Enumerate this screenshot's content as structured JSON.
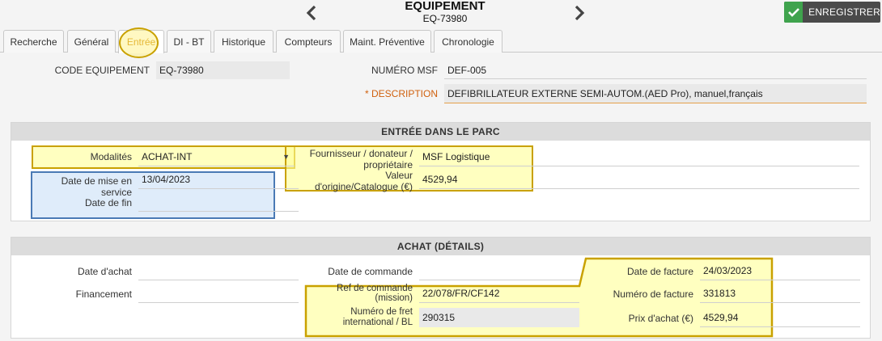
{
  "header": {
    "title": "EQUIPEMENT",
    "code": "EQ-73980",
    "save_label": "ENREGISTRER"
  },
  "tabs": [
    {
      "label": "Recherche"
    },
    {
      "label": "Général"
    },
    {
      "label": "Entrée"
    },
    {
      "label": "DI - BT"
    },
    {
      "label": "Historique"
    },
    {
      "label": "Compteurs"
    },
    {
      "label": "Maint. Préventive"
    },
    {
      "label": "Chronologie"
    }
  ],
  "top": {
    "code_label": "CODE EQUIPEMENT",
    "code_value": "EQ-73980",
    "msf_label": "NUMÉRO MSF",
    "msf_value": "DEF-005",
    "desc_star": "*",
    "desc_label": "DESCRIPTION",
    "desc_value": "DEFIBRILLATEUR EXTERNE SEMI-AUTOM.(AED Pro), manuel,français"
  },
  "entree": {
    "title": "ENTRÉE DANS LE PARC",
    "modalites_label": "Modalités",
    "modalites_value": "ACHAT-INT",
    "fournisseur_label": "Fournisseur / donateur / propriétaire",
    "fournisseur_value": "MSF Logistique",
    "valeur_label": "Valeur d'origine/Catalogue (€)",
    "valeur_value": "4529,94",
    "mise_label": "Date de mise en service",
    "mise_value": "13/04/2023",
    "fin_label": "Date de fin",
    "fin_value": ""
  },
  "achat": {
    "title": "ACHAT (DÉTAILS)",
    "date_achat_label": "Date d'achat",
    "date_achat_value": "",
    "financement_label": "Financement",
    "financement_value": "",
    "date_commande_label": "Date de commande",
    "date_commande_value": "",
    "ref_commande_label": "Ref de commande (mission)",
    "ref_commande_value": "22/078/FR/CF142",
    "fret_label": "Numéro de fret international / BL",
    "fret_value": "290315",
    "date_facture_label": "Date de facture",
    "date_facture_value": "24/03/2023",
    "num_facture_label": "Numéro de facture",
    "num_facture_value": "331813",
    "prix_label": "Prix d'achat (€)",
    "prix_value": "4529,94"
  },
  "colors": {
    "save_bg": "#4a4a4a",
    "save_check": "#3fa34d",
    "required": "#d0600d",
    "highlight_gold": "#c9a100",
    "highlight_blue": "#4a7ab5"
  },
  "icons": [
    "chevron-left-icon",
    "chevron-right-icon",
    "check-icon",
    "dropdown-caret-icon"
  ]
}
